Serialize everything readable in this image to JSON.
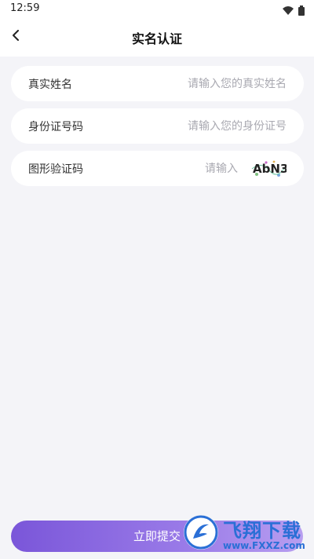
{
  "status_bar": {
    "time": "12:59"
  },
  "header": {
    "title": "实名认证"
  },
  "form": {
    "name": {
      "label": "真实姓名",
      "placeholder": "请输入您的真实姓名",
      "value": ""
    },
    "id_number": {
      "label": "身份证号码",
      "placeholder": "请输入您的身份证号",
      "value": ""
    },
    "captcha": {
      "label": "图形验证码",
      "placeholder": "请输入",
      "value": "",
      "image_text": "AbN3"
    }
  },
  "submit": {
    "label": "立即提交"
  },
  "watermark": {
    "title": "飞翔下载",
    "url": "www.FXXZ.com"
  },
  "colors": {
    "accent_start": "#7a56d9",
    "accent_end": "#b89ef0",
    "page_bg": "#f4f4f8"
  }
}
